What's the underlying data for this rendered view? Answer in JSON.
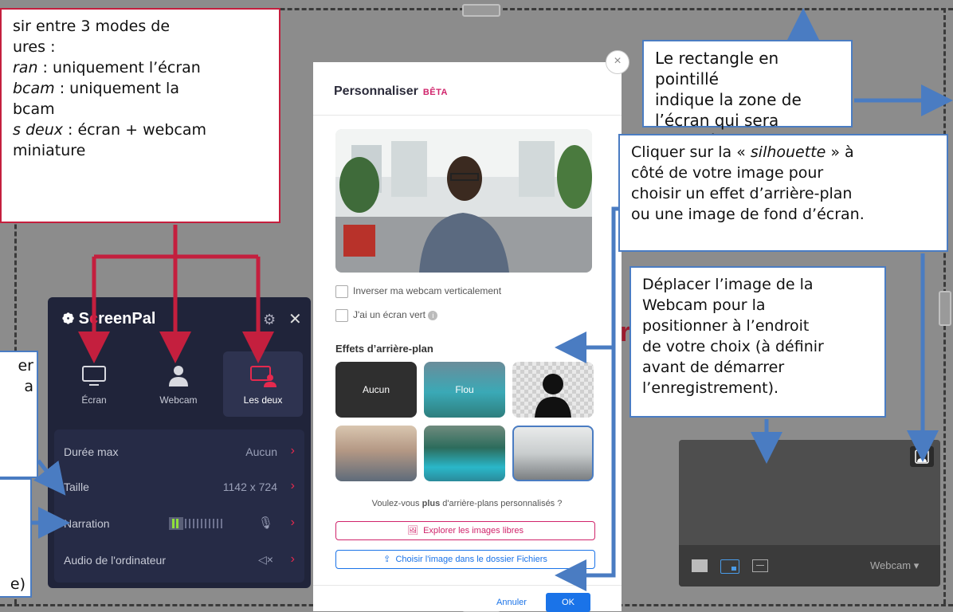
{
  "callouts": {
    "modes": "sir entre 3 modes de\nures :\n<i>ran</i> : uniquement l’écran\n<i>bcam</i> : uniquement la\nbcam\n<i>s deux</i> : écran + webcam\nminiature",
    "rectangle": "Le rectangle en pointillé\nindique la zone de\nl’écran qui sera capturée",
    "silhouette": "Cliquer sur la « <i>silhouette</i> » à\ncôté de votre image pour\nchoisir un effet d’arrière-plan\nou une image de fond d’écran.",
    "deplacer": "Déplacer l’image de la\nWebcam pour la\npositionner à l’endroit\nde votre choix (à définir\navant de démarrer\nl’enregistrement).",
    "left_partial": "er\na",
    "bottom_partial": "e)"
  },
  "screenpal": {
    "logo_prefix": "S",
    "logo_red": "c",
    "logo_rest": "reenPal",
    "modes": [
      {
        "label": "Écran"
      },
      {
        "label": "Webcam"
      },
      {
        "label": "Les deux"
      }
    ],
    "rows": [
      {
        "label": "Durée max",
        "value": "Aucun"
      },
      {
        "label": "Taille",
        "value": "1142 x 724"
      },
      {
        "label": "Narration",
        "value": ""
      },
      {
        "label": "Audio de l'ordinateur",
        "value": ""
      }
    ]
  },
  "dialog": {
    "title": "Personnaliser",
    "beta": "BÊTA",
    "checkbox_flip": "Inverser ma webcam verticalement",
    "checkbox_green": "J'ai un écran vert",
    "effects_title": "Effets d’arrière-plan",
    "tile_none": "Aucun",
    "tile_blur": "Flou",
    "more_prefix": "Voulez-vous ",
    "more_bold": "plus",
    "more_suffix": " d'arrière-plans personnalisés ?",
    "explore_label": "Explorer les images libres",
    "choose_label": "Choisir l'image dans le dossier Fichiers",
    "cancel_label": "Annuler",
    "ok_label": "OK"
  },
  "webcam_preview": {
    "dropdown_label": "Webcam"
  },
  "background_letter": "r",
  "colors": {
    "accent_red": "#c41f3e",
    "arrow_blue": "#4a7cc2",
    "brand_pink": "#d0246b",
    "ok_blue": "#1a73e8"
  }
}
